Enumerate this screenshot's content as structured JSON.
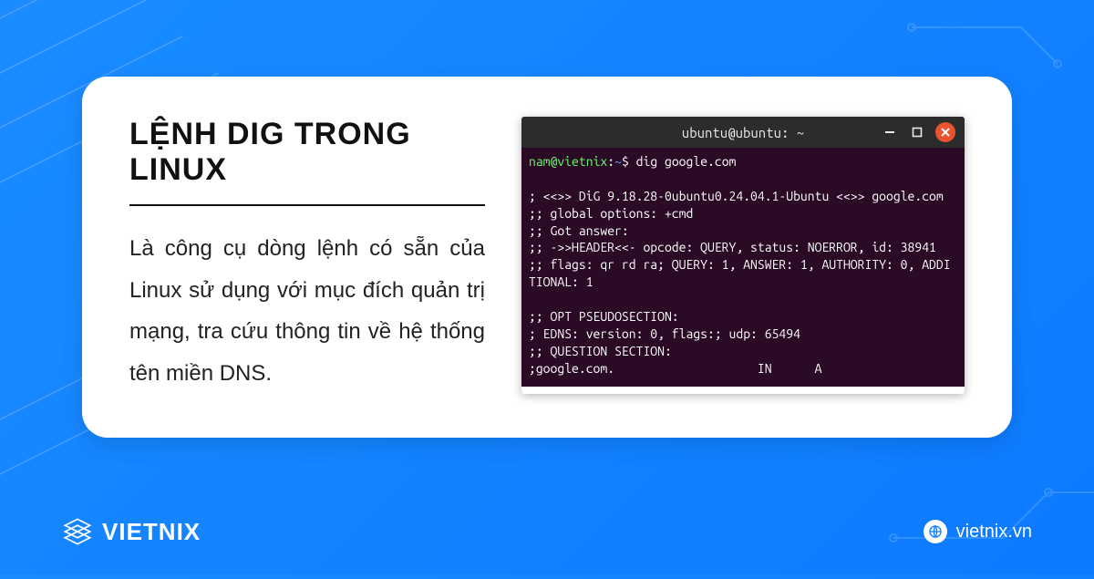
{
  "heading": "LỆNH DIG TRONG LINUX",
  "description": "Là công cụ dòng lệnh có sẵn của Linux sử dụng với mục đích quản trị mạng, tra cứu thông tin về hệ thống tên miền DNS.",
  "terminal": {
    "title": "ubuntu@ubuntu: ~",
    "prompt": {
      "user": "nam",
      "host": "vietnix",
      "path": "~",
      "symbol": "$"
    },
    "command": "dig google.com",
    "output_lines": [
      "",
      "; <<>> DiG 9.18.28-0ubuntu0.24.04.1-Ubuntu <<>> google.com",
      ";; global options: +cmd",
      ";; Got answer:",
      ";; ->>HEADER<<- opcode: QUERY, status: NOERROR, id: 38941",
      ";; flags: qr rd ra; QUERY: 1, ANSWER: 1, AUTHORITY: 0, ADDITIONAL: 1",
      "",
      ";; OPT PSEUDOSECTION:",
      "; EDNS: version: 0, flags:; udp: 65494",
      ";; QUESTION SECTION:",
      ";google.com.                    IN      A"
    ]
  },
  "footer": {
    "brand": "VIETNIX",
    "site": "vietnix.vn"
  }
}
